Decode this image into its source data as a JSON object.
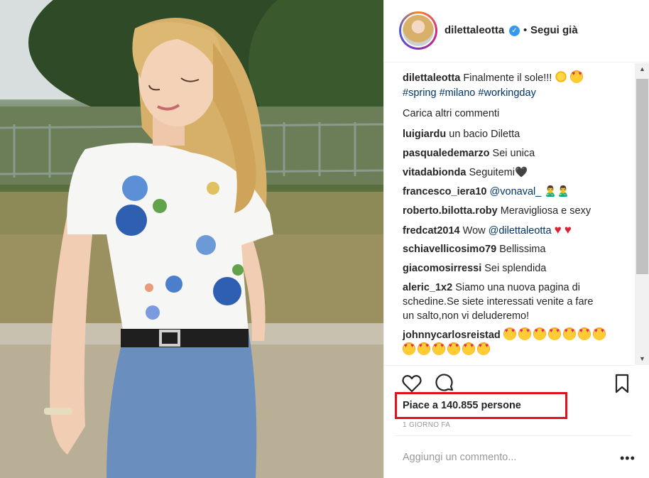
{
  "post": {
    "username": "dilettaleotta",
    "follow_label": "Segui già",
    "dot": "•",
    "caption_text": "Finalmente il sole!!!",
    "hashtags": [
      "#spring",
      "#milano",
      "#workingday"
    ],
    "load_more": "Carica altri commenti",
    "likes": "Piace a 140.855 persone",
    "time": "1 GIORNO FA",
    "add_comment_placeholder": "Aggiungi un commento...",
    "more_label": "•••"
  },
  "comments": [
    {
      "user": "luigiardu",
      "text": "un bacio Diletta"
    },
    {
      "user": "pasqualedemarzo",
      "text": "Sei unica"
    },
    {
      "user": "vitadabionda",
      "text": "Seguitemi🖤"
    },
    {
      "user": "francesco_iera10",
      "mention": "@vonaval_",
      "text": "🙎‍♂🙎‍♂"
    },
    {
      "user": "roberto.bilotta.roby",
      "text": "Meravigliosa e sexy"
    },
    {
      "user": "fredcat2014",
      "text": "Wow",
      "mention": "@dilettaleotta"
    },
    {
      "user": "schiavellicosimo79",
      "text": "Bellissima"
    },
    {
      "user": "giacomosirressi",
      "text": "Sei splendida"
    },
    {
      "user": "aleric_1x2",
      "text_line1": "Siamo una nuova pagina di",
      "text_line2": "schedine.Se siete interessati venite a fare",
      "text_line3": "un salto,non vi deluderemo!"
    },
    {
      "user": "johnnycarlosreistad",
      "text": ""
    }
  ],
  "colors": {
    "accent_blue": "#3897f0",
    "hashtag": "#003569",
    "highlight_box": "#e2101b"
  },
  "icons": [
    "verified-icon",
    "heart-icon",
    "comment-icon",
    "bookmark-icon",
    "more-icon",
    "scroll-up-icon",
    "scroll-down-icon"
  ]
}
